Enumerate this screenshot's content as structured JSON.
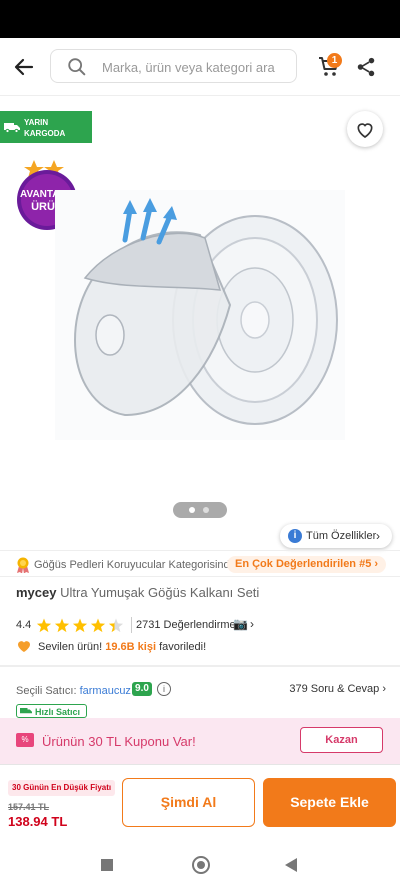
{
  "search": {
    "placeholder": "Marka, ürün veya kategori ara"
  },
  "cart": {
    "count": "1"
  },
  "badges": {
    "cargo_line1": "YARIN",
    "cargo_line2": "KARGODA",
    "avantaj_line1": "AVANTAJLI",
    "avantaj_line2": "ÜRÜN"
  },
  "features": {
    "label": "Tüm Özellikler"
  },
  "category": {
    "text": "Göğüs Pedleri Koruyucular Kategorisinde",
    "rank": "En Çok Değerlendirilen #5"
  },
  "product": {
    "brand": "mycey",
    "name": "Ultra Yumuşak Göğüs Kalkanı Seti"
  },
  "rating": {
    "value": "4.4",
    "stars": 4.4,
    "count": "2731 Değerlendirme"
  },
  "loved": {
    "prefix": "Sevilen ürün! ",
    "highlight": "19.6B kişi",
    "suffix": " favoriledi!"
  },
  "seller": {
    "label": "Seçili Satıcı: ",
    "name": "farmaucuz",
    "score": "9.0",
    "qa": "379 Soru & Cevap",
    "fast_label": "Hızlı Satıcı"
  },
  "coupon": {
    "text": "Ürünün 30 TL Kuponu Var!",
    "button": "Kazan"
  },
  "price": {
    "lowest_tag": "30 Günün En Düşük Fiyatı",
    "old": "157.41 TL",
    "current": "138.94 TL"
  },
  "actions": {
    "buy_now": "Şimdi Al",
    "add_to_cart": "Sepete Ekle"
  },
  "colors": {
    "accent": "#f27a1a",
    "green": "#2da44e",
    "pink": "#d63a6a",
    "red": "#d0021b",
    "purple": "#7b1fa2"
  }
}
